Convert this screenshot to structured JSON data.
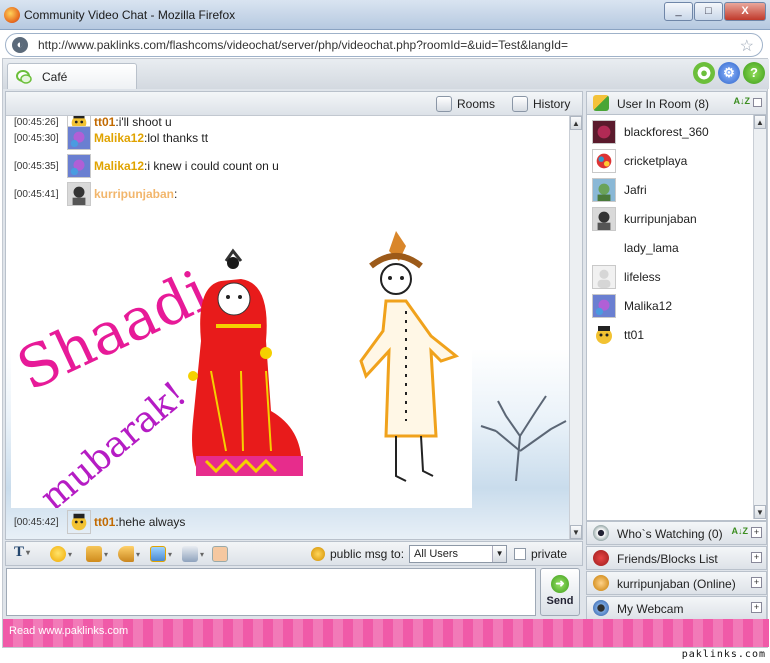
{
  "window": {
    "title": "Community Video Chat - Mozilla Firefox",
    "controls": [
      "_",
      "□",
      "X"
    ]
  },
  "address_bar": {
    "url": "http://www.paklinks.com/flashcoms/videochat/server/php/videochat.php?roomId=&uid=Test&langId="
  },
  "tab": {
    "label": "Café"
  },
  "chat": {
    "header": {
      "rooms_label": "Rooms",
      "history_label": "History"
    },
    "messages": [
      {
        "time": "[00:45:26]",
        "nick": "tt01",
        "sep": ": ",
        "text": "i'll shoot u"
      },
      {
        "time": "[00:45:30]",
        "nick": "Malika12",
        "sep": ": ",
        "text": "lol thanks tt"
      },
      {
        "time": "[00:45:35]",
        "nick": "Malika12",
        "sep": ": ",
        "text": "i knew i could count on u"
      },
      {
        "time": "[00:45:41]",
        "nick": "kurripunjaban",
        "sep": ":",
        "text": ""
      },
      {
        "time": "[00:45:42]",
        "nick": "tt01",
        "sep": ": ",
        "text": "hehe always"
      }
    ],
    "drawing_text": {
      "line1": "Shaadi",
      "line2": "mubarak!"
    }
  },
  "toolbar": {
    "text_tool": "T",
    "public_msg_label": "public msg to:",
    "recipient": "All Users",
    "private_label": "private"
  },
  "composer": {
    "send_label": "Send"
  },
  "users": {
    "header": "User In Room (8)",
    "list": [
      "blackforest_360",
      "cricketplaya",
      "Jafri",
      "kurripunjaban",
      "lady_lama",
      "lifeless",
      "Malika12",
      "tt01"
    ]
  },
  "side_panels": {
    "watching": "Who`s Watching (0)",
    "friends": "Friends/Blocks List",
    "me": "kurripunjaban (Online)",
    "webcam": "My Webcam"
  },
  "footer": {
    "text": "Read www.paklinks.com"
  },
  "watermark": "paklinks.com",
  "colors": {
    "nick_tt01": "#c26a00",
    "nick_malika": "#e0a300",
    "nick_kurri": "#f2b66c",
    "footer_pink": "#f05aa8"
  }
}
